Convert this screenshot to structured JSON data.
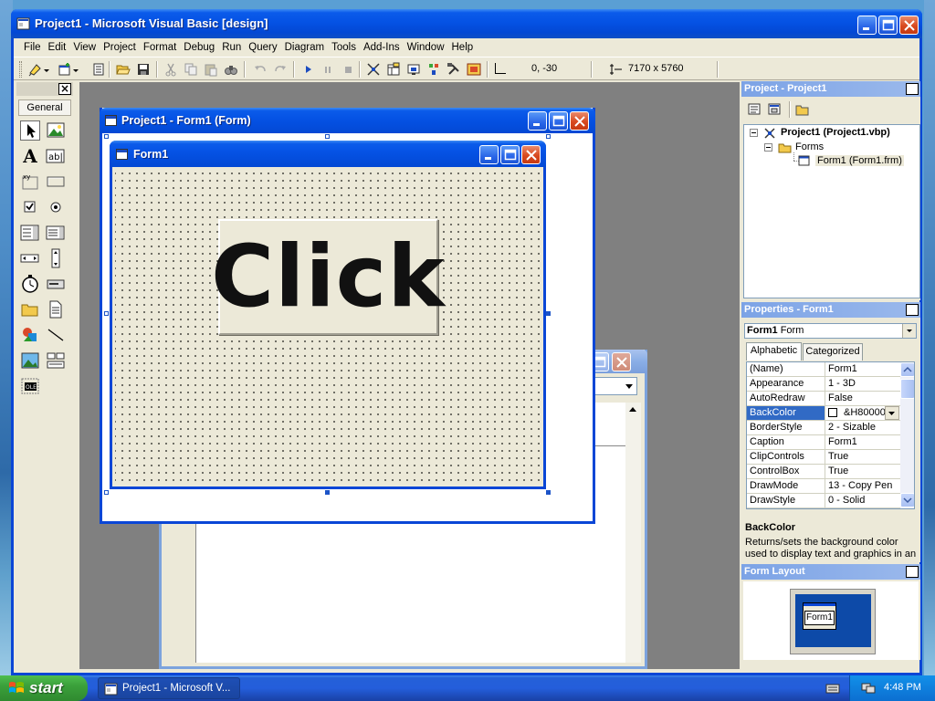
{
  "window": {
    "title": "Project1 - Microsoft Visual Basic [design]"
  },
  "menu": [
    "File",
    "Edit",
    "View",
    "Project",
    "Format",
    "Debug",
    "Run",
    "Query",
    "Diagram",
    "Tools",
    "Add-Ins",
    "Window",
    "Help"
  ],
  "toolbar": {
    "position": "0, -30",
    "size": "7170 x 5760"
  },
  "toolbox": {
    "tab_label": "General"
  },
  "designer": {
    "title": "Project1 - Form1 (Form)"
  },
  "form1": {
    "title": "Form1",
    "button_caption": "Click"
  },
  "project_panel": {
    "title": "Project - Project1",
    "tree": {
      "root": "Project1 (Project1.vbp)",
      "folder": "Forms",
      "item": "Form1 (Form1.frm)"
    }
  },
  "properties_panel": {
    "title": "Properties - Form1",
    "object_name": "Form1",
    "object_type": "Form",
    "tabs": [
      "Alphabetic",
      "Categorized"
    ],
    "rows": [
      {
        "name": "(Name)",
        "value": "Form1"
      },
      {
        "name": "Appearance",
        "value": "1 - 3D"
      },
      {
        "name": "AutoRedraw",
        "value": "False"
      },
      {
        "name": "BackColor",
        "value": "&H80000"
      },
      {
        "name": "BorderStyle",
        "value": "2 - Sizable"
      },
      {
        "name": "Caption",
        "value": "Form1"
      },
      {
        "name": "ClipControls",
        "value": "True"
      },
      {
        "name": "ControlBox",
        "value": "True"
      },
      {
        "name": "DrawMode",
        "value": "13 - Copy Pen"
      },
      {
        "name": "DrawStyle",
        "value": "0 - Solid"
      }
    ],
    "description_title": "BackColor",
    "description_text": "Returns/sets the background color used to display text and graphics in an"
  },
  "layout_panel": {
    "title": "Form Layout",
    "form_label": "Form1"
  },
  "taskbar": {
    "start_label": "start",
    "task_label": "Project1 - Microsoft V...",
    "clock": "4:48 PM"
  },
  "colors": {
    "xp_blue": "#0a46d6",
    "selection": "#316ac5",
    "face": "#ece9d8",
    "workspace": "#808080"
  }
}
